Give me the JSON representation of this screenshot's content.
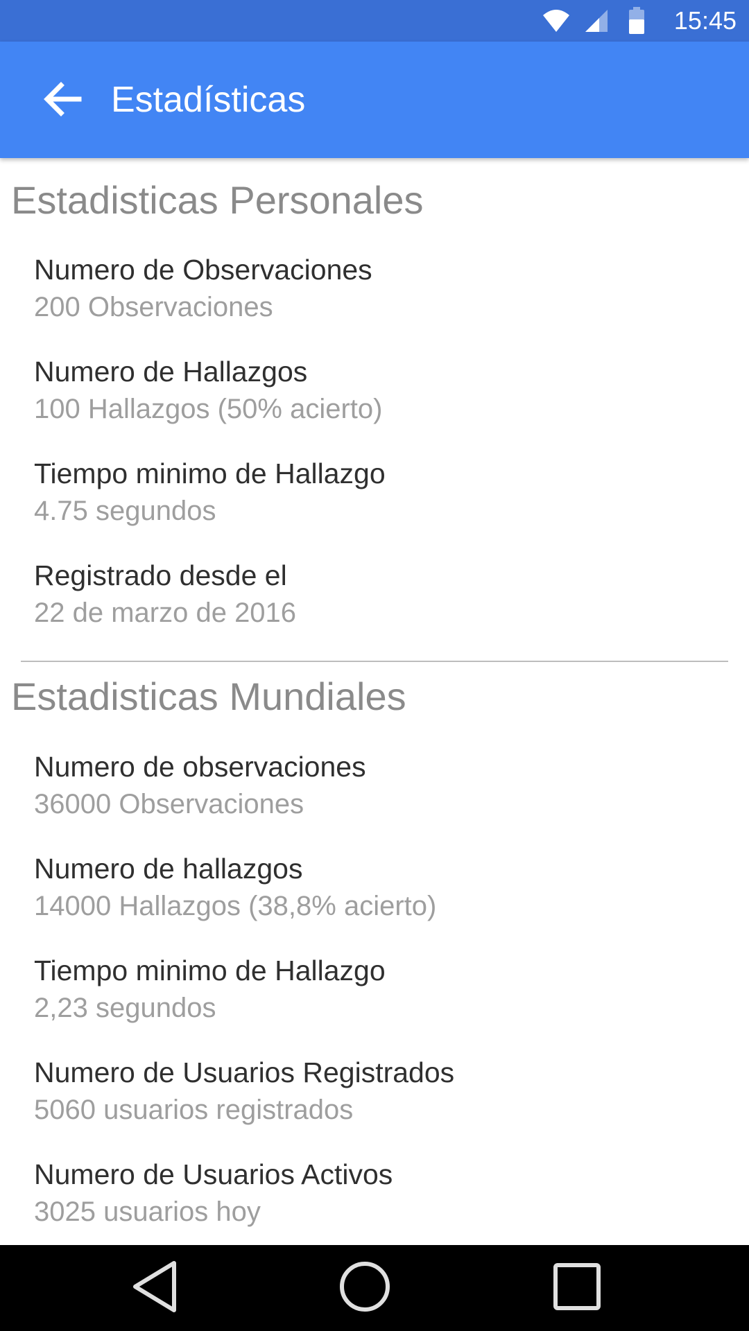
{
  "status_bar": {
    "time": "15:45",
    "icons": [
      "wifi-icon",
      "signal-icon",
      "battery-icon"
    ]
  },
  "app_bar": {
    "title": "Estadísticas",
    "back_icon": "arrow-back-icon"
  },
  "personal": {
    "header": "Estadisticas Personales",
    "items": [
      {
        "label": "Numero de Observaciones",
        "value": "200 Observaciones"
      },
      {
        "label": "Numero de Hallazgos",
        "value": "100 Hallazgos (50% acierto)"
      },
      {
        "label": "Tiempo minimo de Hallazgo",
        "value": "4.75 segundos"
      },
      {
        "label": "Registrado desde el",
        "value": "22 de marzo de 2016"
      }
    ]
  },
  "world": {
    "header": "Estadisticas Mundiales",
    "items": [
      {
        "label": "Numero de observaciones",
        "value": "36000 Observaciones"
      },
      {
        "label": "Numero de hallazgos",
        "value": "14000 Hallazgos (38,8% acierto)"
      },
      {
        "label": "Tiempo minimo de Hallazgo",
        "value": "2,23 segundos"
      },
      {
        "label": "Numero de Usuarios Registrados",
        "value": "5060 usuarios registrados"
      },
      {
        "label": "Numero de Usuarios Activos",
        "value": "3025 usuarios hoy"
      }
    ]
  },
  "nav_bar": {
    "icons": [
      "back-triangle-icon",
      "home-circle-icon",
      "recents-square-icon"
    ]
  },
  "colors": {
    "status_bar": "#3a6fd4",
    "app_bar": "#4285f4",
    "header_text": "#8a8a8a",
    "label_text": "#2f2f2f",
    "value_text": "#9e9e9e"
  }
}
